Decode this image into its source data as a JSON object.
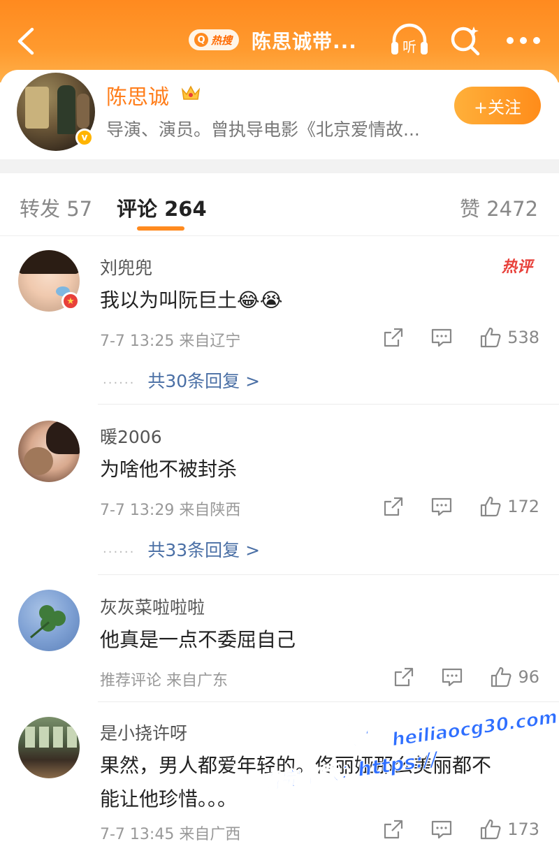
{
  "header": {
    "hot_label": "热搜",
    "topic_title": "陈思诚带...",
    "back_icon": "chevron-left-icon",
    "listen_icon": "headphones-icon",
    "listen_label": "听",
    "search_icon": "search-icon",
    "more_icon": "more-icon"
  },
  "author": {
    "name": "陈思诚",
    "description": "导演、演员。曾执导电影《北京爱情故...",
    "follow_label": "+关注",
    "verified_icon": "verified-badge-icon",
    "crown_icon": "crown-icon"
  },
  "tabs": {
    "repost": "转发 57",
    "comments": "评论 264",
    "likes": "赞 2472"
  },
  "colors": {
    "brand_orange": "#ff8a1f",
    "link_blue": "#4a6fa5",
    "hot_red": "#e8403a"
  },
  "comments": [
    {
      "user": "刘兜兜",
      "text": "我以为叫阮巨土😂😭",
      "meta": "7-7 13:25  来自辽宁",
      "likes": "538",
      "replies": "共30条回复 >",
      "hot_tag": "热评"
    },
    {
      "user": "暖2006",
      "text": "为啥他不被封杀",
      "meta": "7-7 13:29  来自陕西",
      "likes": "172",
      "replies": "共33条回复 >"
    },
    {
      "user": "灰灰菜啦啦啦",
      "text": "他真是一点不委屈自己",
      "meta": "推荐评论  来自广东",
      "likes": "96"
    },
    {
      "user": "是小挠许呀",
      "text_line1": "果然，男人都爱年轻的。佟丽娅那么美丽都不",
      "text_line2": "能让他珍惜。。。",
      "meta": "7-7 13:45  来自广西",
      "likes": "173"
    }
  ],
  "watermark": {
    "site_name": "黑料吃瓜网",
    "site_url": "heiliaocg30.com",
    "full_label": "看完整版：https://"
  }
}
